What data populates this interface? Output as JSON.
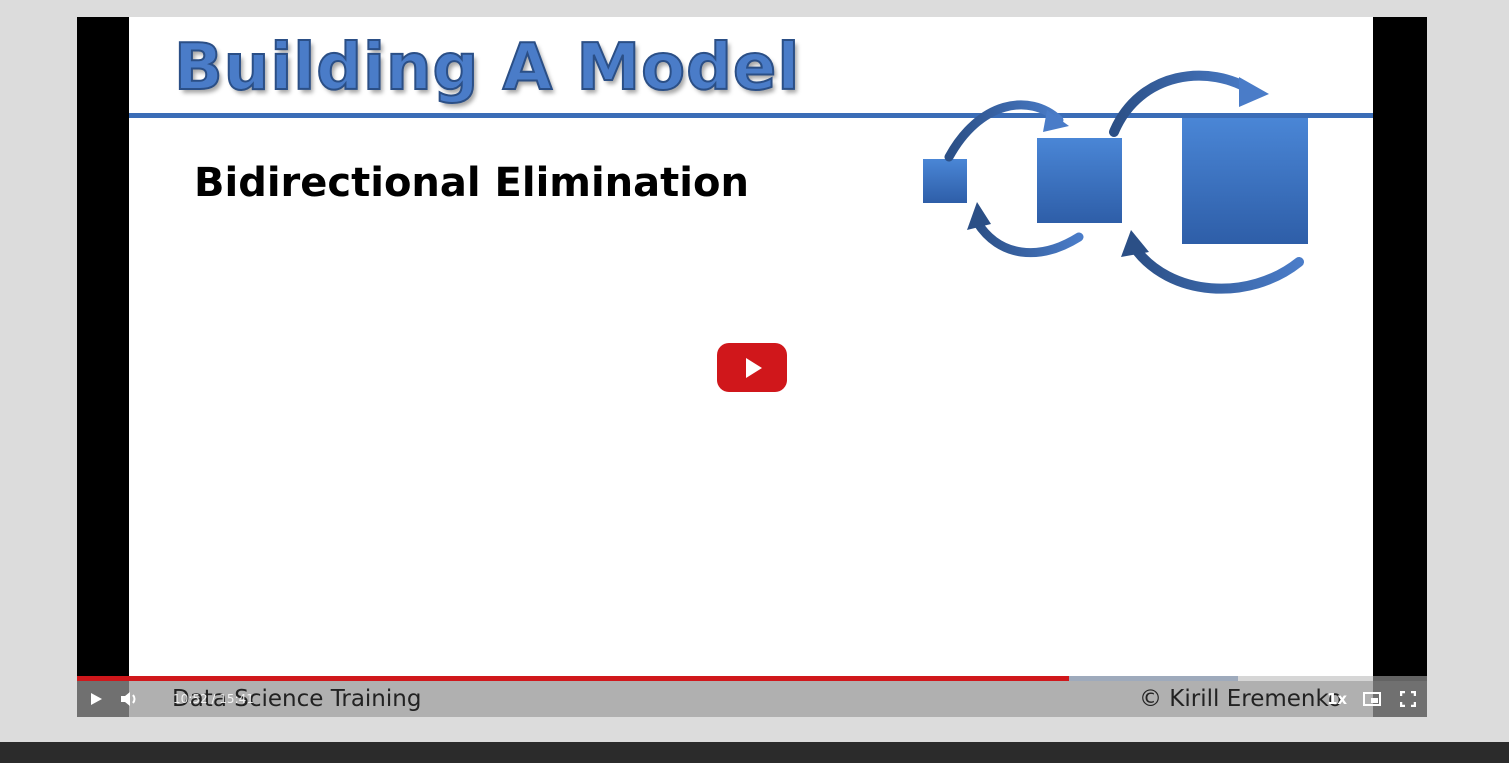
{
  "slide": {
    "title": "Building A Model",
    "subtitle": "Bidirectional Elimination",
    "footer_left": "Data Science Training",
    "footer_right": "© Kirill Eremenko"
  },
  "player": {
    "current_time": "10:52",
    "duration": "15:41",
    "time_separator": "/",
    "speed": "1x",
    "played_fraction": 0.735,
    "buffered_fraction": 0.86
  },
  "colors": {
    "accent": "#d0171b",
    "slide_blue": "#3b6db7"
  },
  "icons": {
    "play": "play-icon",
    "volume": "volume-icon",
    "pip": "picture-in-picture-icon",
    "fullscreen": "fullscreen-icon",
    "big_play": "youtube-play-icon"
  }
}
